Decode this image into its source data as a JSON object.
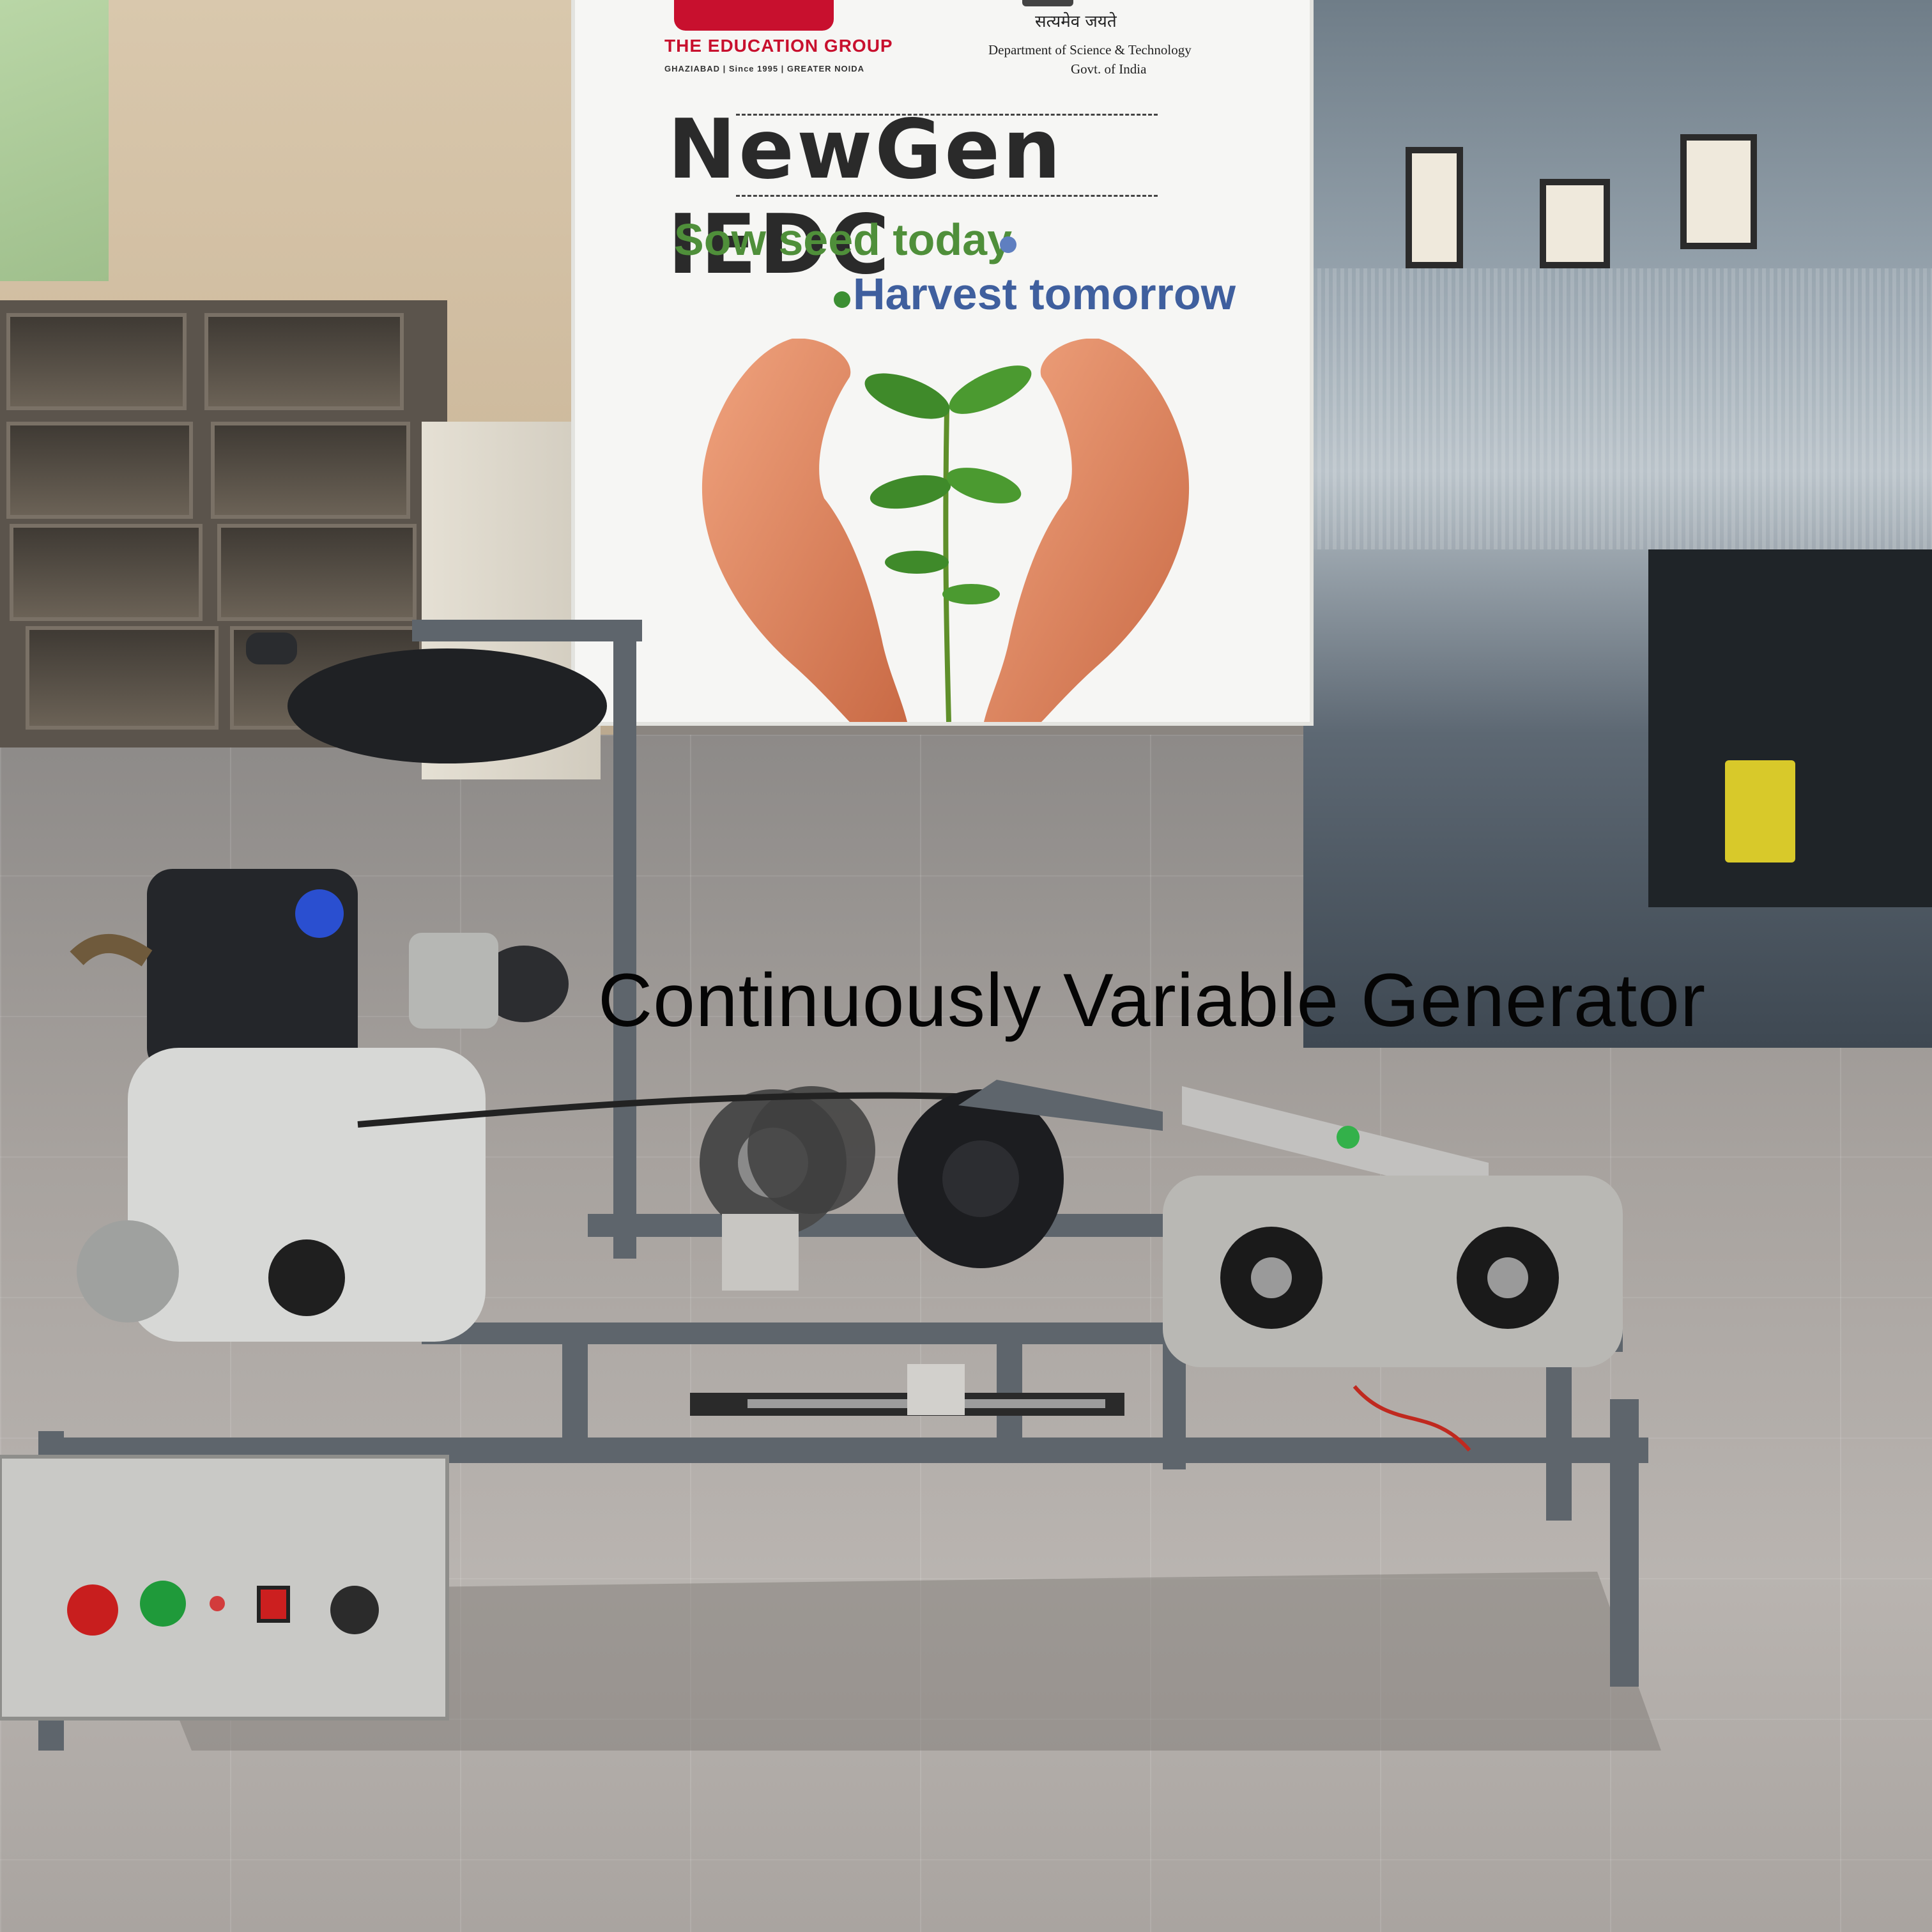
{
  "poster": {
    "logo_name": "THE EDUCATION GROUP",
    "logo_tagline": "GHAZIABAD  |  Since 1995  |  GREATER NOIDA",
    "dst_motto": "सत्यमेव जयते",
    "dst_line1": "Department of Science & Technology",
    "dst_line2": "Govt. of India",
    "headline": "NewGen IEDC",
    "slogan_1": "Sow seed today",
    "slogan_2": "Harvest tomorrow"
  },
  "caption": "Continuously Variable Generator",
  "colors": {
    "logo_red": "#c8102e",
    "slogan_green": "#4f8f3a",
    "slogan_blue": "#3f5f9e",
    "frame_grey": "#5e656c",
    "panel_steel": "#c9c9c6"
  },
  "control_panel": {
    "buttons": [
      "red-push-button",
      "green-push-button",
      "indicator-light",
      "rocker-switch",
      "black-knob"
    ]
  }
}
